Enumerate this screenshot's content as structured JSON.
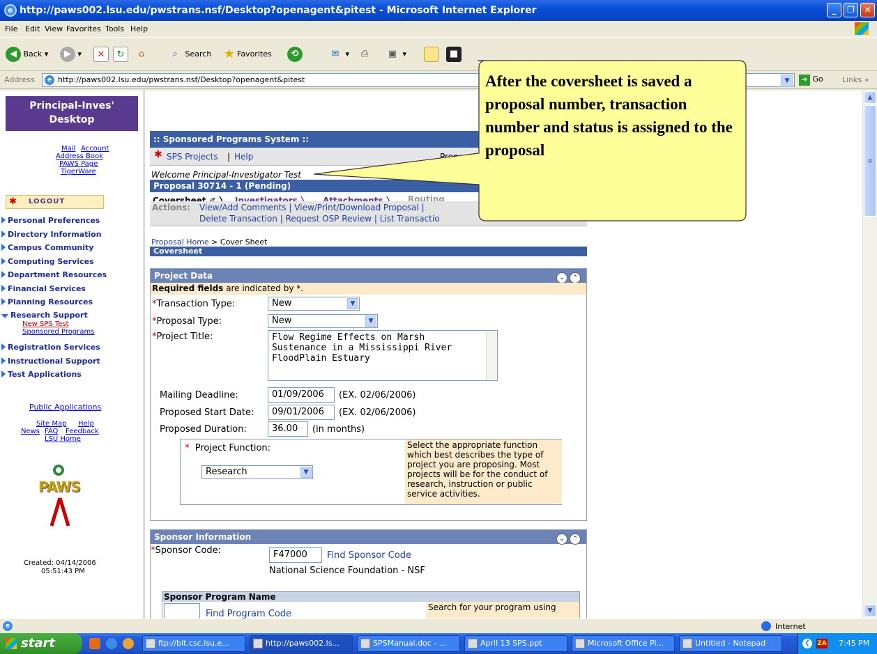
{
  "window": {
    "title": "http://paws002.lsu.edu/pwstrans.nsf/Desktop?openagent&pitest - Microsoft Internet Explorer"
  },
  "menu": [
    "File",
    "Edit",
    "View",
    "Favorites",
    "Tools",
    "Help"
  ],
  "toolbar": {
    "back": "Back",
    "search": "Search",
    "favorites": "Favorites"
  },
  "address": {
    "label": "Address",
    "url": "http://paws002.lsu.edu/pwstrans.nsf/Desktop?openagent&pitest",
    "go": "Go",
    "links": "Links"
  },
  "sidebar": {
    "title": "Principal-Inves' Desktop",
    "top_links": [
      "Mail",
      "Account",
      "Address Book",
      "PAWS Page",
      "TigerWare"
    ],
    "logout": "LOGOUT",
    "nav": [
      "Personal Preferences",
      "Directory Information",
      "Campus Community",
      "Computing Services",
      "Department Resources",
      "Financial Services",
      "Planning Resources",
      "Research Support",
      "Registration Services",
      "Instructional Support",
      "Test Applications"
    ],
    "research_sub": [
      "New SPS Test",
      "Sponsored Programs"
    ],
    "public_apps": "Public Applications",
    "bottom_links": [
      "Site Map",
      "Help",
      "News",
      "FAQ",
      "Feedback",
      "LSU Home"
    ],
    "logo": "PAWS",
    "created_label": "Created: 04/14/2006",
    "created_time": "05:51:43 PM"
  },
  "sps": {
    "header": ":: Sponsored Programs System ::",
    "nav_projects": "SPS Projects",
    "nav_sep": "|",
    "nav_help": "Help",
    "nav_right": "Prop",
    "welcome": "Welcome Principal-Investigator Test",
    "proposal_bar": "Proposal 30714 - 1 (Pending)",
    "tabs": [
      "Coversheet",
      "Investigators",
      "Attachments",
      "Routing"
    ],
    "actions_label": "Actions:",
    "actions_line1": "View/Add Comments | View/Print/Download Proposal |",
    "actions_line2": "Delete Transaction | Request OSP Review | List Transactio",
    "breadcrumb_link": "Proposal Home",
    "breadcrumb_rest": " > Cover Sheet",
    "section_title": "Coversheet"
  },
  "project_data": {
    "title": "Project Data",
    "required_bold": "Required fields",
    "required_rest": " are indicated by *.",
    "transaction_type_label": "Transaction Type:",
    "transaction_type_value": "New",
    "proposal_type_label": "Proposal Type:",
    "proposal_type_value": "New",
    "project_title_label": "Project Title:",
    "project_title_value": "Flow Regime Effects on Marsh Sustenance in a Mississippi River FloodPlain Estuary",
    "mailing_deadline_label": "Mailing Deadline:",
    "mailing_deadline_value": "01/09/2006",
    "mailing_deadline_hint": "(EX. 02/06/2006)",
    "start_date_label": "Proposed Start Date:",
    "start_date_value": "09/01/2006",
    "start_date_hint": "(EX. 02/06/2006)",
    "duration_label": "Proposed Duration:",
    "duration_value": "36.00",
    "duration_hint": "(in months)",
    "function_label": "Project Function:",
    "function_value": "Research",
    "function_help": "Select the appropriate function which best describes the type of project you are proposing. Most projects will be for the conduct of research, instruction or public service activities."
  },
  "sponsor": {
    "title": "Sponsor Information",
    "code_label": "Sponsor Code:",
    "code_value": "F47000",
    "find_code": "Find Sponsor Code",
    "sponsor_name": "National Science Foundation - NSF",
    "program_name_header": "Sponsor Program Name",
    "find_program": "Find Program Code",
    "program_help": "Search for your program using"
  },
  "callout": {
    "text": "After the coversheet is saved a proposal number, transaction number and status is assigned to the proposal"
  },
  "status": {
    "zone": "Internet"
  },
  "taskbar": {
    "start": "start",
    "tasks": [
      "ftp://bit.csc.lsu.e...",
      "http://paws002.ls...",
      "SPSManual.doc - ...",
      "April 13 SPS.ppt",
      "Microsoft Office Pi...",
      "Untitled - Notepad"
    ],
    "clock": "7:45 PM"
  },
  "colors": {
    "callout_fill": "#ffff99",
    "sidebar_header": "#5a3a8e",
    "section_bar": "#3a5fa5",
    "help_bg": "#fdeacb"
  }
}
